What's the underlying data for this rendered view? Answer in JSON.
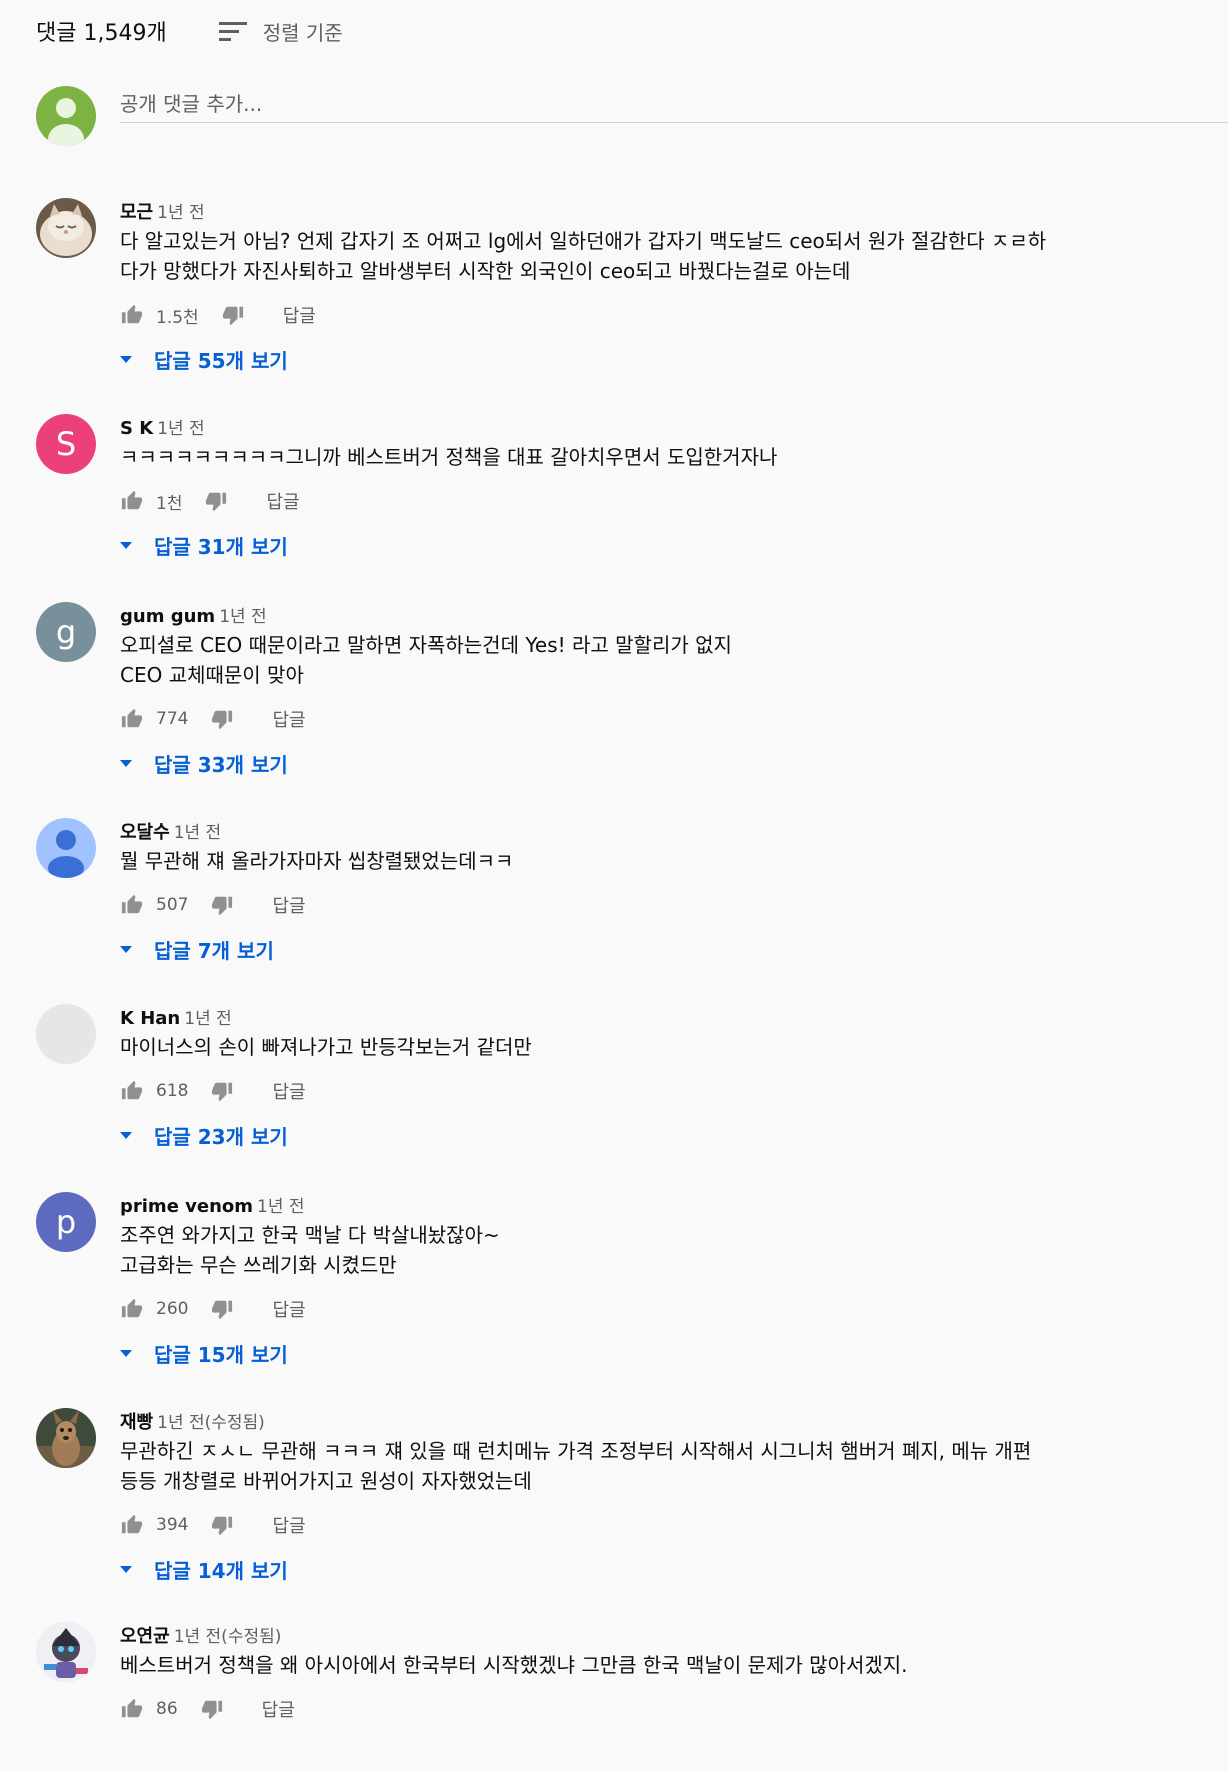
{
  "header": {
    "count": "댓글 1,549개",
    "sort_label": "정렬 기준",
    "sort_icon": "sort-icon"
  },
  "add_comment": {
    "placeholder": "공개 댓글 추가...",
    "avatar_color": "#7cb342"
  },
  "colors": {
    "link": "#065fd4",
    "secondary": "#606060",
    "background": "#f9f9f9"
  },
  "comments": [
    {
      "author": "모근",
      "time": "1년 전",
      "text": "다 알고있는거 아님? 언제 갑자기 조 어쩌고 lg에서 일하던애가 갑자기 맥도날드 ceo되서 원가 절감한다 ㅈㄹ하\n다가  망했다가 자진사퇴하고 알바생부터 시작한 외국인이 ceo되고 바꿨다는걸로 아는데",
      "likes": "1.5천",
      "reply": "답글",
      "view_replies": "답글 55개 보기",
      "avatar": "cat-photo"
    },
    {
      "author": "S K",
      "time": "1년 전",
      "text": "ㅋㅋㅋㅋㅋㅋㅋㅋㅋ그니까 베스트버거 정책을 대표 갈아치우면서 도입한거자나",
      "likes": "1천",
      "reply": "답글",
      "view_replies": "답글 31개 보기",
      "avatar": "letter",
      "avatar_letter": "S",
      "avatar_color": "#ec407a"
    },
    {
      "author": "gum gum",
      "time": "1년 전",
      "text": "오피셜로 CEO 때문이라고 말하면 자폭하는건데 Yes! 라고 말할리가 없지\nCEO 교체때문이 맞아",
      "likes": "774",
      "reply": "답글",
      "view_replies": "답글 33개 보기",
      "avatar": "letter",
      "avatar_letter": "g",
      "avatar_color": "#78909c"
    },
    {
      "author": "오달수",
      "time": "1년 전",
      "text": "뭘 무관해 쟤 올라가자마자 씹창렬됐었는데ㅋㅋ",
      "likes": "507",
      "reply": "답글",
      "view_replies": "답글 7개 보기",
      "avatar": "default-person",
      "avatar_color": "#a0c3ff"
    },
    {
      "author": "K Han",
      "time": "1년 전",
      "text": "마이너스의 손이 빠져나가고 반등각보는거 같더만",
      "likes": "618",
      "reply": "답글",
      "view_replies": "답글 23개 보기",
      "avatar": "blank",
      "avatar_color": "#e6e6e6"
    },
    {
      "author": "prime venom",
      "time": "1년 전",
      "text": "조주연 와가지고 한국 맥날 다 박살내놨잖아~\n고급화는 무슨 쓰레기화 시켰드만",
      "likes": "260",
      "reply": "답글",
      "view_replies": "답글 15개 보기",
      "avatar": "letter",
      "avatar_letter": "p",
      "avatar_color": "#5c6bc0"
    },
    {
      "author": "재빵",
      "time": "1년 전(수정됨)",
      "text": "무관하긴 ㅈㅅㄴ 무관해 ㅋㅋㅋ 쟤 있을 때 런치메뉴 가격 조정부터 시작해서 시그니처 햄버거 폐지, 메뉴 개편\n등등 개창렬로 바뀌어가지고 원성이 자자했었는데",
      "likes": "394",
      "reply": "답글",
      "view_replies": "답글 14개 보기",
      "avatar": "kangaroo-photo"
    },
    {
      "author": "오연균",
      "time": "1년 전(수정됨)",
      "text": "베스트버거 정책을 왜 아시아에서 한국부터 시작했겠냐 그만큼 한국 맥날이 문제가 많아서겠지.",
      "likes": "86",
      "reply": "답글",
      "view_replies": "",
      "avatar": "character-art"
    }
  ]
}
